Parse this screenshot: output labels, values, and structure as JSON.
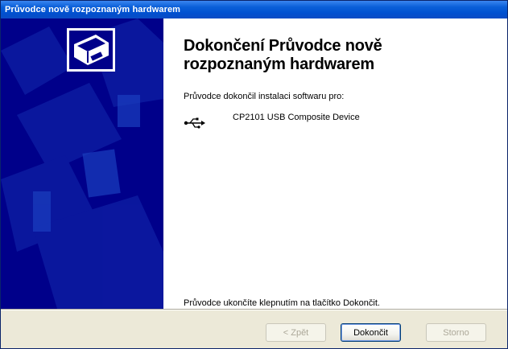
{
  "window": {
    "title": "Průvodce nově rozpoznaným hardwarem"
  },
  "main": {
    "heading_line1": "Dokončení Průvodce nově",
    "heading_line2": "rozpoznaným hardwarem",
    "subtitle": "Průvodce dokončil instalaci softwaru pro:",
    "device": {
      "icon": "usb-icon",
      "name": "CP2101 USB Composite Device"
    },
    "footer": "Průvodce ukončíte klepnutím na tlačítko Dokončit."
  },
  "buttons": {
    "back": "< Zpět",
    "finish": "Dokončit",
    "cancel": "Storno"
  },
  "colors": {
    "side_panel": "#00008a",
    "titlebar": "#0a5fd8"
  }
}
